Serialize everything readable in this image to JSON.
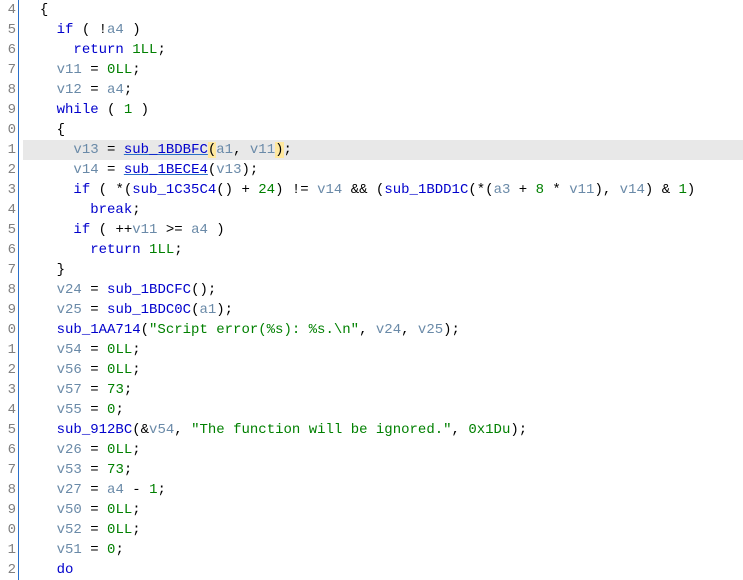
{
  "chart_data": null,
  "editor": {
    "font": "Consolas",
    "highlighted_line_index": 7,
    "gutter_start": 4,
    "lines": [
      {
        "n": "4",
        "indent": 2,
        "tokens": [
          {
            "t": "{",
            "c": ""
          }
        ]
      },
      {
        "n": "5",
        "indent": 4,
        "tokens": [
          {
            "t": "if",
            "c": "kw"
          },
          {
            "t": " ( !",
            "c": ""
          },
          {
            "t": "a4",
            "c": "var"
          },
          {
            "t": " )",
            "c": ""
          }
        ]
      },
      {
        "n": "6",
        "indent": 6,
        "tokens": [
          {
            "t": "return",
            "c": "kw"
          },
          {
            "t": " ",
            "c": ""
          },
          {
            "t": "1LL",
            "c": "num"
          },
          {
            "t": ";",
            "c": ""
          }
        ]
      },
      {
        "n": "7",
        "indent": 4,
        "tokens": [
          {
            "t": "v11",
            "c": "var"
          },
          {
            "t": " = ",
            "c": ""
          },
          {
            "t": "0LL",
            "c": "num"
          },
          {
            "t": ";",
            "c": ""
          }
        ]
      },
      {
        "n": "8",
        "indent": 4,
        "tokens": [
          {
            "t": "v12",
            "c": "var"
          },
          {
            "t": " = ",
            "c": ""
          },
          {
            "t": "a4",
            "c": "var"
          },
          {
            "t": ";",
            "c": ""
          }
        ]
      },
      {
        "n": "9",
        "indent": 4,
        "tokens": [
          {
            "t": "while",
            "c": "kw"
          },
          {
            "t": " ( ",
            "c": ""
          },
          {
            "t": "1",
            "c": "num"
          },
          {
            "t": " )",
            "c": ""
          }
        ]
      },
      {
        "n": "0",
        "indent": 4,
        "tokens": [
          {
            "t": "{",
            "c": ""
          }
        ]
      },
      {
        "n": "1",
        "indent": 6,
        "hl": true,
        "tokens": [
          {
            "t": "v13",
            "c": "var"
          },
          {
            "t": " = ",
            "c": ""
          },
          {
            "t": "sub_1BDBFC",
            "c": "func underline"
          },
          {
            "t": "(",
            "c": "paren-b"
          },
          {
            "t": "a1",
            "c": "var"
          },
          {
            "t": ", ",
            "c": ""
          },
          {
            "t": "v11",
            "c": "var"
          },
          {
            "t": ")",
            "c": "paren-b"
          },
          {
            "t": ";",
            "c": ""
          }
        ]
      },
      {
        "n": "2",
        "indent": 6,
        "tokens": [
          {
            "t": "v14",
            "c": "var"
          },
          {
            "t": " = ",
            "c": ""
          },
          {
            "t": "sub_1BECE4",
            "c": "func underline"
          },
          {
            "t": "(",
            "c": ""
          },
          {
            "t": "v13",
            "c": "var"
          },
          {
            "t": ");",
            "c": ""
          }
        ]
      },
      {
        "n": "3",
        "indent": 6,
        "tokens": [
          {
            "t": "if",
            "c": "kw"
          },
          {
            "t": " ( *(",
            "c": ""
          },
          {
            "t": "sub_1C35C4",
            "c": "func"
          },
          {
            "t": "() + ",
            "c": ""
          },
          {
            "t": "24",
            "c": "num"
          },
          {
            "t": ") != ",
            "c": ""
          },
          {
            "t": "v14",
            "c": "var"
          },
          {
            "t": " && (",
            "c": ""
          },
          {
            "t": "sub_1BDD1C",
            "c": "func"
          },
          {
            "t": "(*(",
            "c": ""
          },
          {
            "t": "a3",
            "c": "var"
          },
          {
            "t": " + ",
            "c": ""
          },
          {
            "t": "8",
            "c": "num"
          },
          {
            "t": " * ",
            "c": ""
          },
          {
            "t": "v11",
            "c": "var"
          },
          {
            "t": "), ",
            "c": ""
          },
          {
            "t": "v14",
            "c": "var"
          },
          {
            "t": ") & ",
            "c": ""
          },
          {
            "t": "1",
            "c": "num"
          },
          {
            "t": ")",
            "c": ""
          }
        ]
      },
      {
        "n": "4",
        "indent": 8,
        "tokens": [
          {
            "t": "break",
            "c": "kw"
          },
          {
            "t": ";",
            "c": ""
          }
        ]
      },
      {
        "n": "5",
        "indent": 6,
        "tokens": [
          {
            "t": "if",
            "c": "kw"
          },
          {
            "t": " ( ++",
            "c": ""
          },
          {
            "t": "v11",
            "c": "var"
          },
          {
            "t": " >= ",
            "c": ""
          },
          {
            "t": "a4",
            "c": "var"
          },
          {
            "t": " )",
            "c": ""
          }
        ]
      },
      {
        "n": "6",
        "indent": 8,
        "tokens": [
          {
            "t": "return",
            "c": "kw"
          },
          {
            "t": " ",
            "c": ""
          },
          {
            "t": "1LL",
            "c": "num"
          },
          {
            "t": ";",
            "c": ""
          }
        ]
      },
      {
        "n": "7",
        "indent": 4,
        "tokens": [
          {
            "t": "}",
            "c": ""
          }
        ]
      },
      {
        "n": "8",
        "indent": 4,
        "tokens": [
          {
            "t": "v24",
            "c": "var"
          },
          {
            "t": " = ",
            "c": ""
          },
          {
            "t": "sub_1BDCFC",
            "c": "func"
          },
          {
            "t": "();",
            "c": ""
          }
        ]
      },
      {
        "n": "9",
        "indent": 4,
        "tokens": [
          {
            "t": "v25",
            "c": "var"
          },
          {
            "t": " = ",
            "c": ""
          },
          {
            "t": "sub_1BDC0C",
            "c": "func"
          },
          {
            "t": "(",
            "c": ""
          },
          {
            "t": "a1",
            "c": "var"
          },
          {
            "t": ");",
            "c": ""
          }
        ]
      },
      {
        "n": "0",
        "indent": 4,
        "tokens": [
          {
            "t": "sub_1AA714",
            "c": "func"
          },
          {
            "t": "(",
            "c": ""
          },
          {
            "t": "\"Script error(%s): %s.\\n\"",
            "c": "str"
          },
          {
            "t": ", ",
            "c": ""
          },
          {
            "t": "v24",
            "c": "var"
          },
          {
            "t": ", ",
            "c": ""
          },
          {
            "t": "v25",
            "c": "var"
          },
          {
            "t": ");",
            "c": ""
          }
        ]
      },
      {
        "n": "1",
        "indent": 4,
        "tokens": [
          {
            "t": "v54",
            "c": "var"
          },
          {
            "t": " = ",
            "c": ""
          },
          {
            "t": "0LL",
            "c": "num"
          },
          {
            "t": ";",
            "c": ""
          }
        ]
      },
      {
        "n": "2",
        "indent": 4,
        "tokens": [
          {
            "t": "v56",
            "c": "var"
          },
          {
            "t": " = ",
            "c": ""
          },
          {
            "t": "0LL",
            "c": "num"
          },
          {
            "t": ";",
            "c": ""
          }
        ]
      },
      {
        "n": "3",
        "indent": 4,
        "tokens": [
          {
            "t": "v57",
            "c": "var"
          },
          {
            "t": " = ",
            "c": ""
          },
          {
            "t": "73",
            "c": "num"
          },
          {
            "t": ";",
            "c": ""
          }
        ]
      },
      {
        "n": "4",
        "indent": 4,
        "tokens": [
          {
            "t": "v55",
            "c": "var"
          },
          {
            "t": " = ",
            "c": ""
          },
          {
            "t": "0",
            "c": "num"
          },
          {
            "t": ";",
            "c": ""
          }
        ]
      },
      {
        "n": "5",
        "indent": 4,
        "tokens": [
          {
            "t": "sub_912BC",
            "c": "func"
          },
          {
            "t": "(&",
            "c": ""
          },
          {
            "t": "v54",
            "c": "var"
          },
          {
            "t": ", ",
            "c": ""
          },
          {
            "t": "\"The function will be ignored.\"",
            "c": "str"
          },
          {
            "t": ", ",
            "c": ""
          },
          {
            "t": "0x1Du",
            "c": "num"
          },
          {
            "t": ");",
            "c": ""
          }
        ]
      },
      {
        "n": "6",
        "indent": 4,
        "tokens": [
          {
            "t": "v26",
            "c": "var"
          },
          {
            "t": " = ",
            "c": ""
          },
          {
            "t": "0LL",
            "c": "num"
          },
          {
            "t": ";",
            "c": ""
          }
        ]
      },
      {
        "n": "7",
        "indent": 4,
        "tokens": [
          {
            "t": "v53",
            "c": "var"
          },
          {
            "t": " = ",
            "c": ""
          },
          {
            "t": "73",
            "c": "num"
          },
          {
            "t": ";",
            "c": ""
          }
        ]
      },
      {
        "n": "8",
        "indent": 4,
        "tokens": [
          {
            "t": "v27",
            "c": "var"
          },
          {
            "t": " = ",
            "c": ""
          },
          {
            "t": "a4",
            "c": "var"
          },
          {
            "t": " - ",
            "c": ""
          },
          {
            "t": "1",
            "c": "num"
          },
          {
            "t": ";",
            "c": ""
          }
        ]
      },
      {
        "n": "9",
        "indent": 4,
        "tokens": [
          {
            "t": "v50",
            "c": "var"
          },
          {
            "t": " = ",
            "c": ""
          },
          {
            "t": "0LL",
            "c": "num"
          },
          {
            "t": ";",
            "c": ""
          }
        ]
      },
      {
        "n": "0",
        "indent": 4,
        "tokens": [
          {
            "t": "v52",
            "c": "var"
          },
          {
            "t": " = ",
            "c": ""
          },
          {
            "t": "0LL",
            "c": "num"
          },
          {
            "t": ";",
            "c": ""
          }
        ]
      },
      {
        "n": "1",
        "indent": 4,
        "tokens": [
          {
            "t": "v51",
            "c": "var"
          },
          {
            "t": " = ",
            "c": ""
          },
          {
            "t": "0",
            "c": "num"
          },
          {
            "t": ";",
            "c": ""
          }
        ]
      },
      {
        "n": "2",
        "indent": 4,
        "tokens": [
          {
            "t": "do",
            "c": "kw"
          }
        ]
      }
    ]
  }
}
